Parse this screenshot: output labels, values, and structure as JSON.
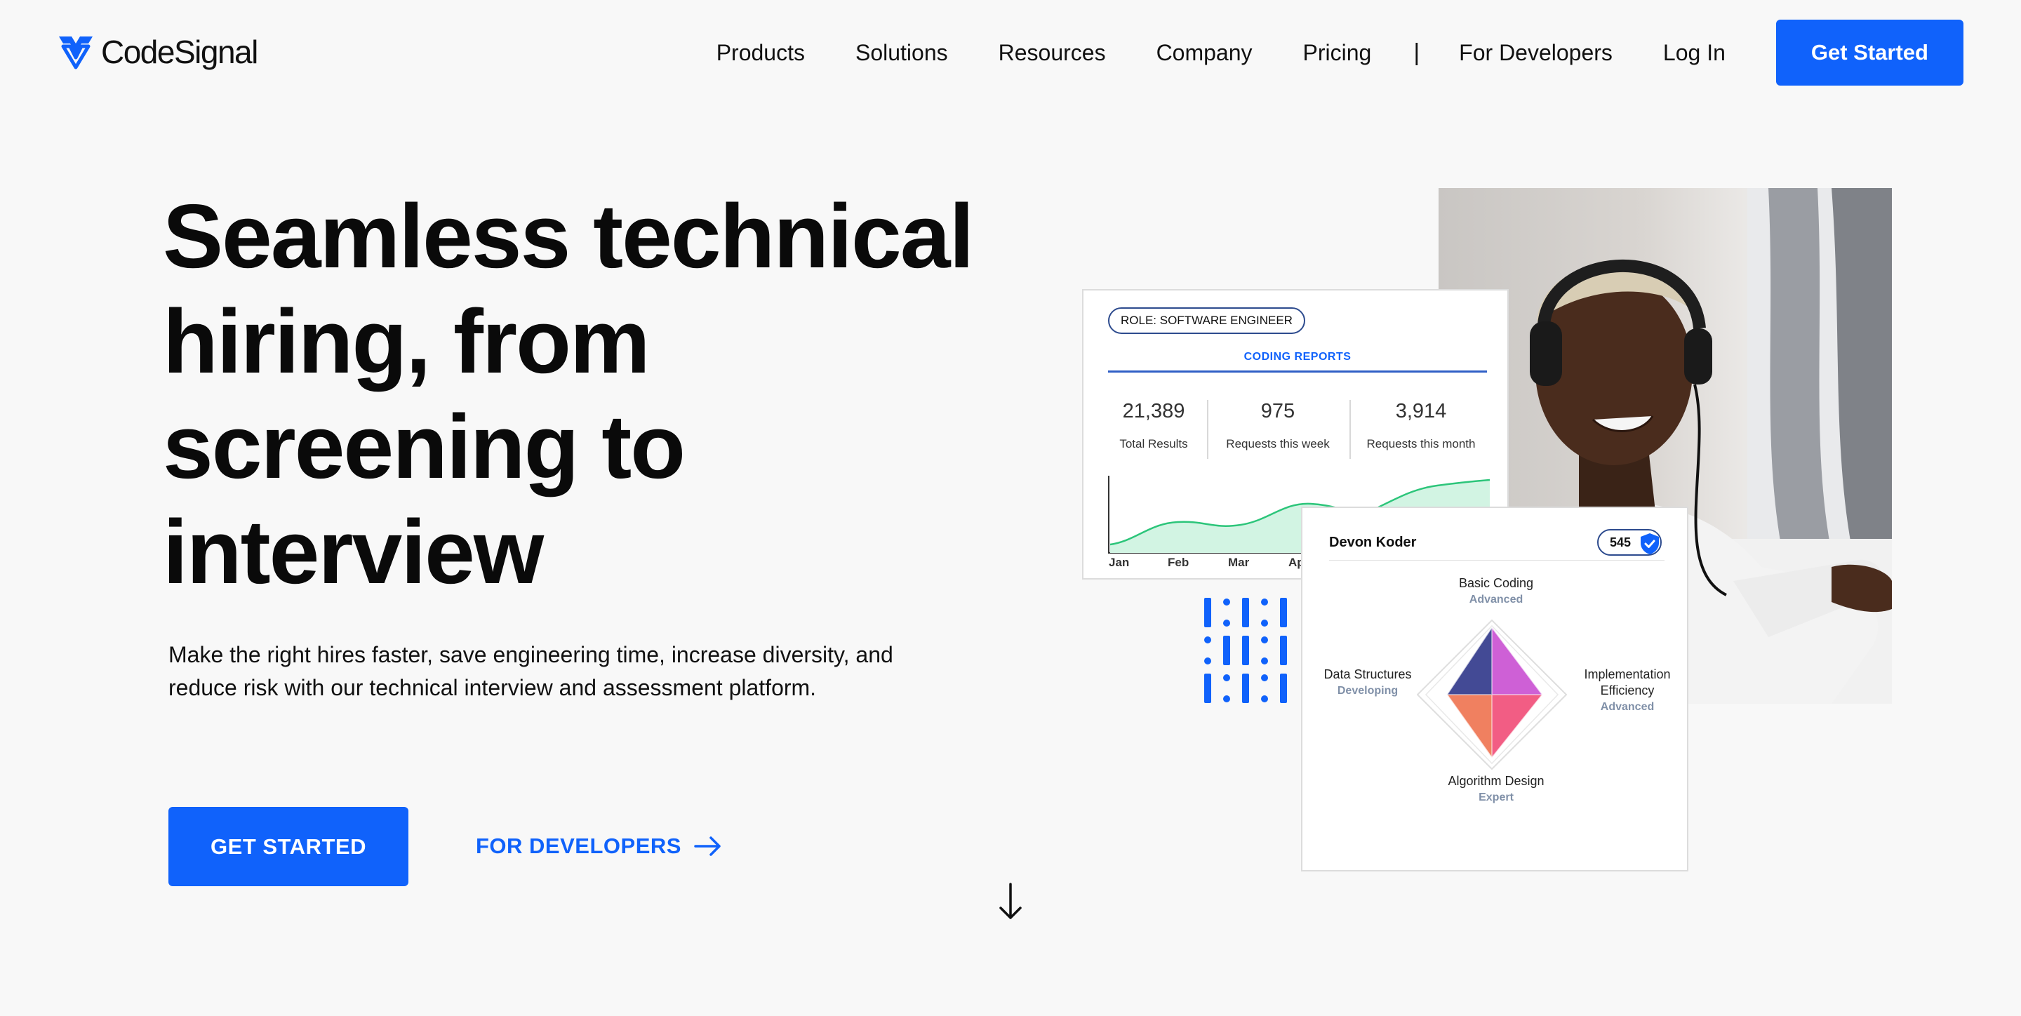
{
  "brand": {
    "name": "CodeSignal",
    "accent": "#1062fb"
  },
  "nav": {
    "items": [
      "Products",
      "Solutions",
      "Resources",
      "Company",
      "Pricing"
    ],
    "separator": "|",
    "for_developers": "For Developers",
    "login": "Log In",
    "cta": "Get Started"
  },
  "hero": {
    "title": "Seamless technical hiring, from screening to interview",
    "subtitle": "Make the right hires faster, save engineering time, increase diversity, and reduce risk with our technical interview and assessment platform.",
    "primary_cta": "GET STARTED",
    "secondary_cta": "FOR DEVELOPERS"
  },
  "report_card": {
    "role": "ROLE: SOFTWARE ENGINEER",
    "title": "CODING REPORTS",
    "stats": [
      {
        "value": "21,389",
        "label": "Total Results"
      },
      {
        "value": "975",
        "label": "Requests this week"
      },
      {
        "value": "3,914",
        "label": "Requests this month"
      }
    ],
    "months": [
      "Jan",
      "Feb",
      "Mar",
      "Ap"
    ]
  },
  "profile_card": {
    "name": "Devon Koder",
    "score": "545",
    "skills": {
      "top": {
        "name": "Basic Coding",
        "level": "Advanced"
      },
      "left": {
        "name": "Data Structures",
        "level": "Developing"
      },
      "right": {
        "name": "Implementation Efficiency",
        "level": "Advanced"
      },
      "bottom": {
        "name": "Algorithm Design",
        "level": "Expert"
      }
    }
  },
  "icons": [
    "codesignal-logo-icon",
    "arrow-right-icon",
    "arrow-down-icon",
    "verified-shield-icon"
  ]
}
